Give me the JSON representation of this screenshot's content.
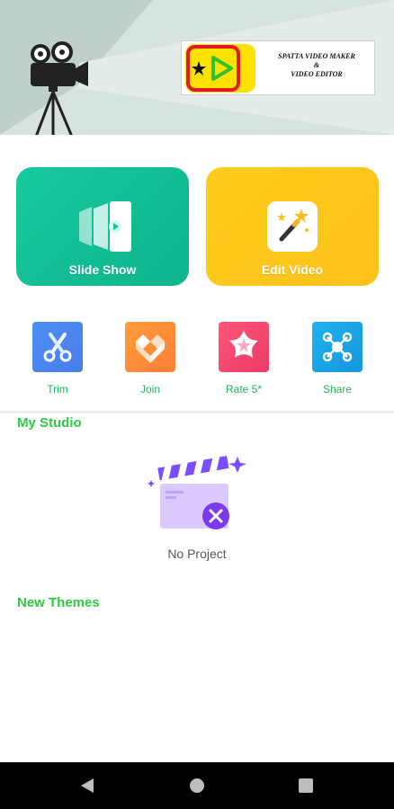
{
  "banner": {
    "logo_text_line1": "SPATTA VIDEO MAKER",
    "logo_text_line2": "&",
    "logo_text_line3": "VIDEO EDITOR",
    "background_color": "#d6e3df"
  },
  "cards": {
    "slide_show": {
      "label": "Slide Show",
      "color": "#14c195",
      "icon": "slides-icon"
    },
    "edit_video": {
      "label": "Edit Video",
      "color": "#fdc41b",
      "icon": "magic-wand-icon"
    }
  },
  "tools": [
    {
      "label": "Trim",
      "icon": "scissors-icon",
      "color": "#4c86f0"
    },
    {
      "label": "Join",
      "icon": "join-icon",
      "color": "#ff8c38"
    },
    {
      "label": "Rate 5*",
      "icon": "star-icon",
      "color": "#f44870"
    },
    {
      "label": "Share",
      "icon": "share-icon",
      "color": "#1aa6e6"
    }
  ],
  "studio": {
    "title": "My Studio",
    "empty_text": "No Project"
  },
  "themes": {
    "title": "New Themes"
  },
  "accent_color": "#2ecc40",
  "navbar": {
    "buttons": [
      "back-icon",
      "home-icon",
      "recent-apps-icon"
    ]
  }
}
